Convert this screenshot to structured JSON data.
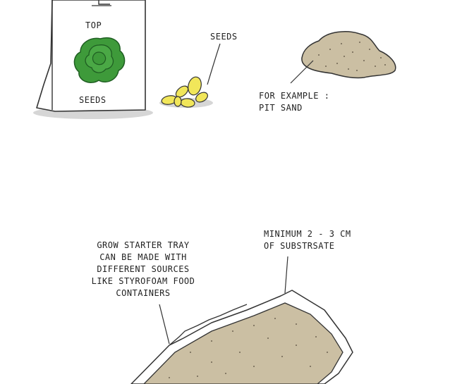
{
  "bag": {
    "top_label": "TOP",
    "bottom_label": "SEEDS"
  },
  "seeds_pile": {
    "label": "SEEDS"
  },
  "sand": {
    "label_line1": "FOR EXAMPLE :",
    "label_line2": "PIT SAND"
  },
  "tray_note": {
    "line1": "GROW STARTER TRAY",
    "line2": "CAN BE MADE WITH",
    "line3": "DIFFERENT SOURCES",
    "line4": "LIKE STYROFOAM FOOD",
    "line5": "CONTAINERS"
  },
  "substrate_note": {
    "line1": "MINIMUM 2 - 3 CM",
    "line2": "OF SUBSTRSATE"
  },
  "colors": {
    "leaf_green": "#3e9a3a",
    "leaf_dark": "#1f5e22",
    "seed_yellow": "#f1e65a",
    "sand_beige": "#cbbfa3",
    "shadow_grey": "#d6d6d6"
  }
}
